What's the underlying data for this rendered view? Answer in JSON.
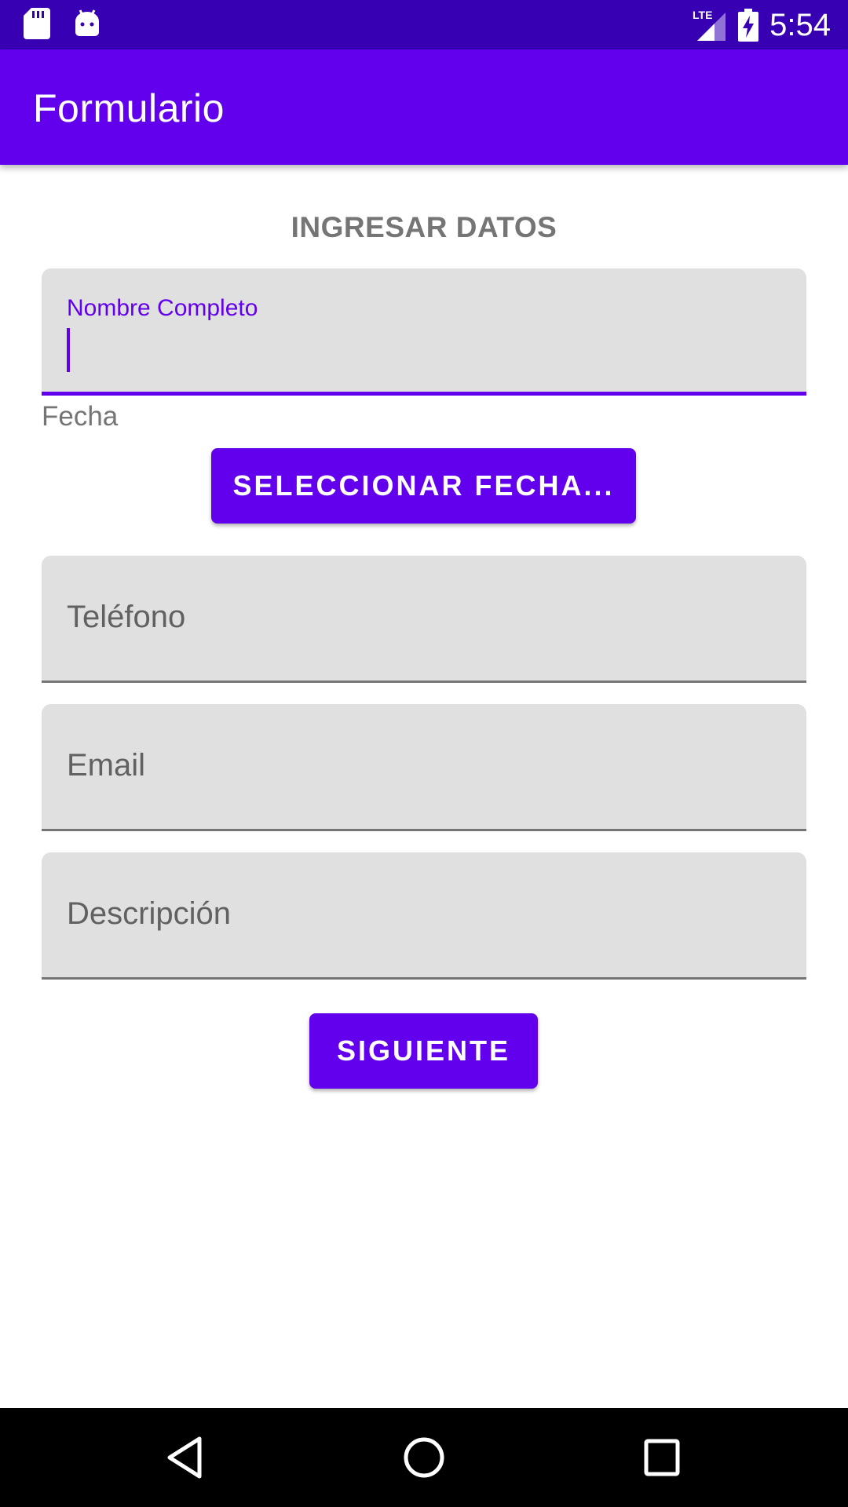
{
  "status_bar": {
    "time": "5:54",
    "network": "LTE",
    "icons": [
      "sd-card-icon",
      "android-icon",
      "signal-icon",
      "battery-charging-icon"
    ]
  },
  "app_bar": {
    "title": "Formulario"
  },
  "form": {
    "section_title": "INGRESAR DATOS",
    "nombre": {
      "label": "Nombre Completo",
      "value": ""
    },
    "fecha_label": "Fecha",
    "fecha_button": "SELECCIONAR FECHA...",
    "telefono_hint": "Teléfono",
    "email_hint": "Email",
    "descripcion_hint": "Descripción",
    "next_button": "SIGUIENTE"
  },
  "colors": {
    "primary": "#6200EE",
    "primary_dark": "#3700B3",
    "field_bg": "#E0E0E0"
  },
  "nav_bar": {
    "icons": [
      "back-icon",
      "home-icon",
      "recents-icon"
    ]
  }
}
